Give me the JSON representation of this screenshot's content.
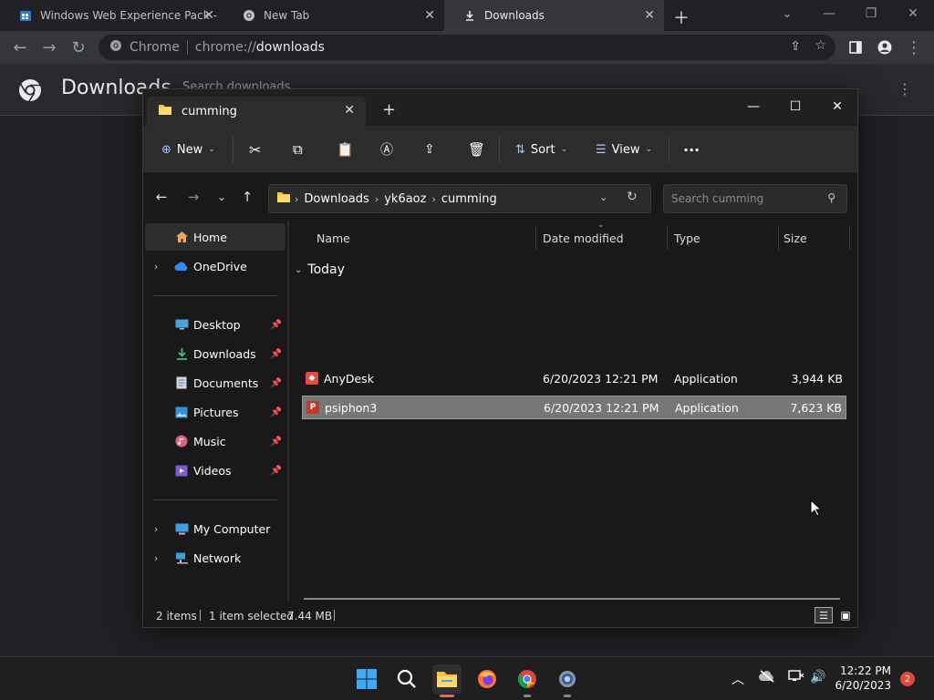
{
  "chrome": {
    "tabs": [
      {
        "title": "Windows Web Experience Pack -",
        "icon": "windows-store-icon"
      },
      {
        "title": "New Tab",
        "icon": "chrome-icon"
      },
      {
        "title": "Downloads",
        "icon": "download-icon",
        "active": true
      }
    ],
    "omnibox": {
      "chip": "Chrome",
      "url_scheme": "chrome://",
      "url_path": "downloads"
    },
    "downloads_title": "Downloads",
    "downloads_search_placeholder": "Search downloads"
  },
  "explorer": {
    "tab_title": "cumming",
    "commands": {
      "new": "New",
      "sort": "Sort",
      "view": "View"
    },
    "breadcrumb": [
      "Downloads",
      "yk6aoz",
      "cumming"
    ],
    "search_placeholder": "Search cumming",
    "nav": {
      "home": "Home",
      "onedrive": "OneDrive",
      "desktop": "Desktop",
      "downloads": "Downloads",
      "documents": "Documents",
      "pictures": "Pictures",
      "music": "Music",
      "videos": "Videos",
      "my_computer": "My Computer",
      "network": "Network"
    },
    "columns": {
      "name": "Name",
      "date": "Date modified",
      "type": "Type",
      "size": "Size"
    },
    "group": "Today",
    "files": [
      {
        "name": "AnyDesk",
        "date": "6/20/2023 12:21 PM",
        "type": "Application",
        "size": "3,944 KB",
        "color": "#e84a3e"
      },
      {
        "name": "psiphon3",
        "date": "6/20/2023 12:21 PM",
        "type": "Application",
        "size": "7,623 KB",
        "color": "#c0392b",
        "selected": true
      }
    ],
    "status": {
      "count": "2 items",
      "selected": "1 item selected",
      "size": "7.44 MB"
    }
  },
  "taskbar": {
    "time": "12:22 PM",
    "date": "6/20/2023",
    "notifications": "2"
  },
  "colors": {
    "accent": "#9fc9ff",
    "selection": "#777777",
    "folder": "#f4c53d"
  }
}
